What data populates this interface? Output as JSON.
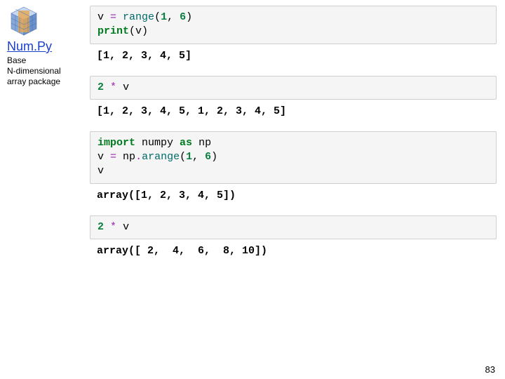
{
  "sidebar": {
    "title": "Num.Py",
    "subtitle_l1": "Base",
    "subtitle_l2": "N-dimensional",
    "subtitle_l3": "array package"
  },
  "cells": {
    "c1": {
      "l1_v": "v ",
      "l1_eq": "=",
      "l1_sp": " ",
      "l1_fn": "range",
      "l1_lp": "(",
      "l1_n1": "1",
      "l1_cm": ", ",
      "l1_n2": "6",
      "l1_rp": ")",
      "l2_kw": "print",
      "l2_lp": "(",
      "l2_v": "v",
      "l2_rp": ")"
    },
    "o1": "[1, 2, 3, 4, 5]",
    "c2": {
      "n": "2",
      "sp1": " ",
      "star": "*",
      "sp2": " ",
      "v": "v"
    },
    "o2": "[1, 2, 3, 4, 5, 1, 2, 3, 4, 5]",
    "c3": {
      "l1_kw": "import",
      "l1_sp1": " ",
      "l1_np": "numpy ",
      "l1_as": "as",
      "l1_sp2": " ",
      "l1_al": "np",
      "l2_v": "v ",
      "l2_eq": "=",
      "l2_sp": " ",
      "l2_np": "np",
      "l2_dot": ".",
      "l2_fn": "arange",
      "l2_lp": "(",
      "l2_n1": "1",
      "l2_cm": ", ",
      "l2_n2": "6",
      "l2_rp": ")",
      "l3_v": "v"
    },
    "o3": "array([1, 2, 3, 4, 5])",
    "c4": {
      "n": "2",
      "sp1": " ",
      "star": "*",
      "sp2": " ",
      "v": "v"
    },
    "o4": "array([ 2,  4,  6,  8, 10])"
  },
  "pageno": "83"
}
